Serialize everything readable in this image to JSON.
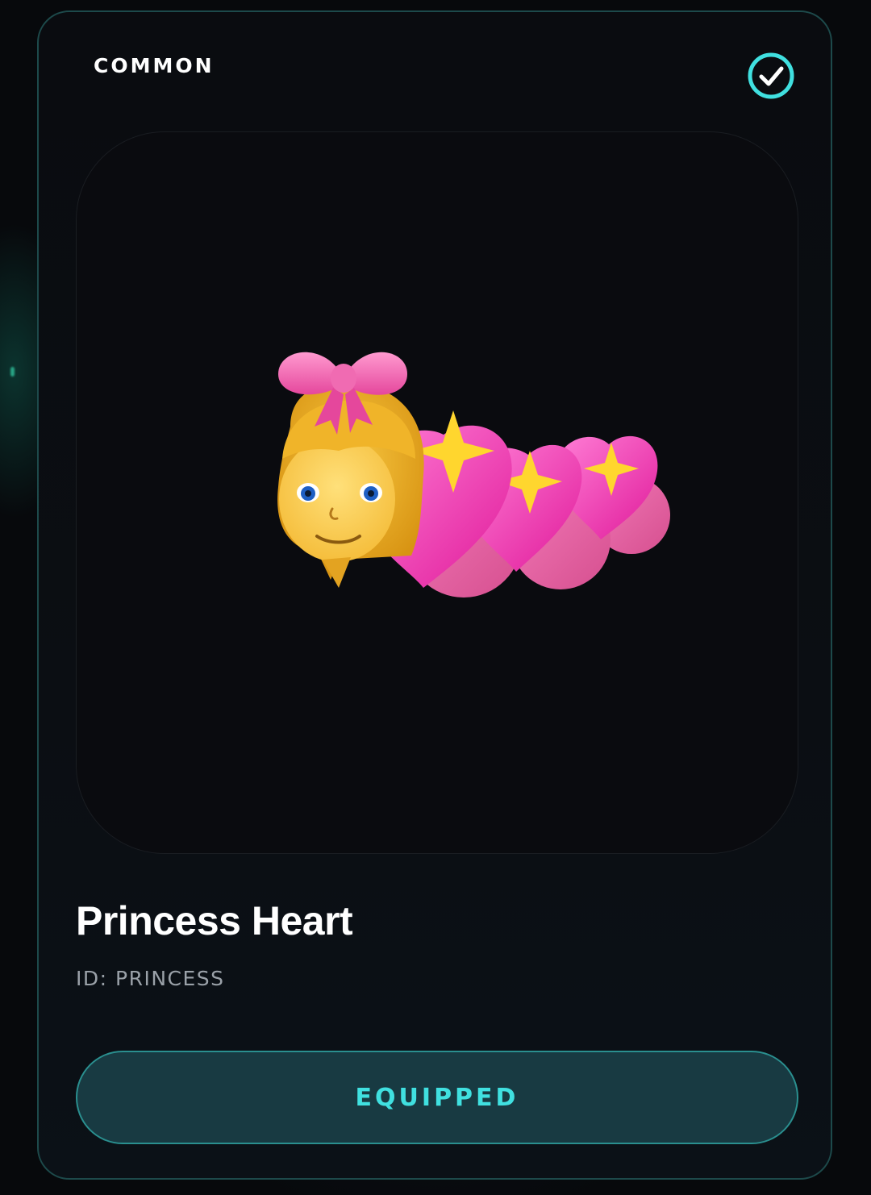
{
  "card": {
    "rarity": "COMMON",
    "equipped_icon": "check-circle-icon",
    "item_name": "Princess Heart",
    "item_id": "ID: PRINCESS",
    "action_label": "EQUIPPED",
    "item_art": "princess-heart-caterpillar",
    "accent_color": "#40e0e0",
    "border_color": "#1d4a4b",
    "button_bg": "#183a42"
  }
}
